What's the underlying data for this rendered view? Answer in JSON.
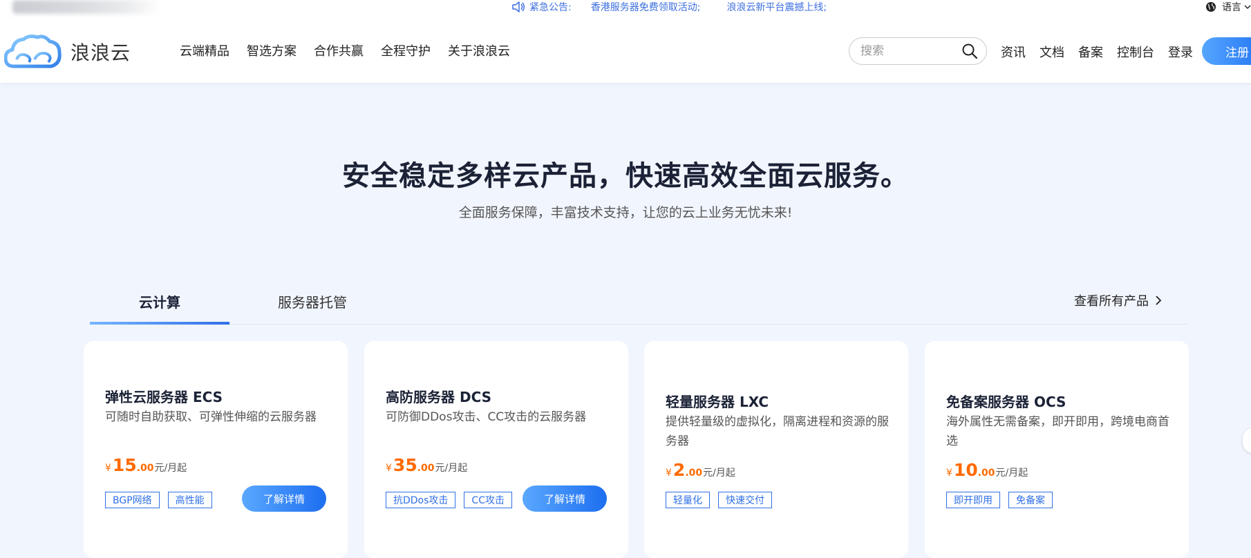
{
  "announcement": {
    "label": "紧急公告:",
    "items": [
      "香港服务器免费领取活动;",
      "浪浪云新平台震撼上线;"
    ]
  },
  "language": {
    "label": "语言"
  },
  "logo": {
    "brand": "浪浪云"
  },
  "nav": {
    "items": [
      "云端精品",
      "智选方案",
      "合作共赢",
      "全程守护",
      "关于浪浪云"
    ]
  },
  "search": {
    "placeholder": "搜索",
    "value": ""
  },
  "header_links": [
    "资讯",
    "文档",
    "备案",
    "控制台",
    "登录"
  ],
  "register_label": "注册",
  "hero": {
    "title": "安全稳定多样云产品，快速高效全面云服务。",
    "subtitle": "全面服务保障，丰富技术支持，让您的云上业务无忧未来!"
  },
  "tabs": {
    "items": [
      "云计算",
      "服务器托管"
    ],
    "active": 0,
    "view_all": "查看所有产品"
  },
  "cards": [
    {
      "title": "弹性云服务器 ECS",
      "desc": "可随时自助获取、可弹性伸缩的云服务器",
      "price_currency": "¥",
      "price_int": "15",
      "price_dec": ".00",
      "price_unit": "元/月起",
      "tags": [
        "BGP网络",
        "高性能"
      ],
      "button": "了解详情"
    },
    {
      "title": "高防服务器 DCS",
      "desc": "可防御DDos攻击、CC攻击的云服务器",
      "price_currency": "¥",
      "price_int": "35",
      "price_dec": ".00",
      "price_unit": "元/月起",
      "tags": [
        "抗DDos攻击",
        "CC攻击"
      ],
      "button": "了解详情"
    },
    {
      "title": "轻量服务器 LXC",
      "desc": "提供轻量级的虚拟化，隔离进程和资源的服务器",
      "price_currency": "¥",
      "price_int": "2",
      "price_dec": ".00",
      "price_unit": "元/月起",
      "tags": [
        "轻量化",
        "快速交付"
      ]
    },
    {
      "title": "免备案服务器 OCS",
      "desc": "海外属性无需备案，即开即用，跨境电商首选",
      "price_currency": "¥",
      "price_int": "10",
      "price_dec": ".00",
      "price_unit": "元/月起",
      "tags": [
        "即开即用",
        "免备案"
      ]
    }
  ],
  "colors": {
    "accent_blue": "#2f6fe6",
    "price_orange": "#ff6a00",
    "page_bg": "#f1f5fd"
  }
}
